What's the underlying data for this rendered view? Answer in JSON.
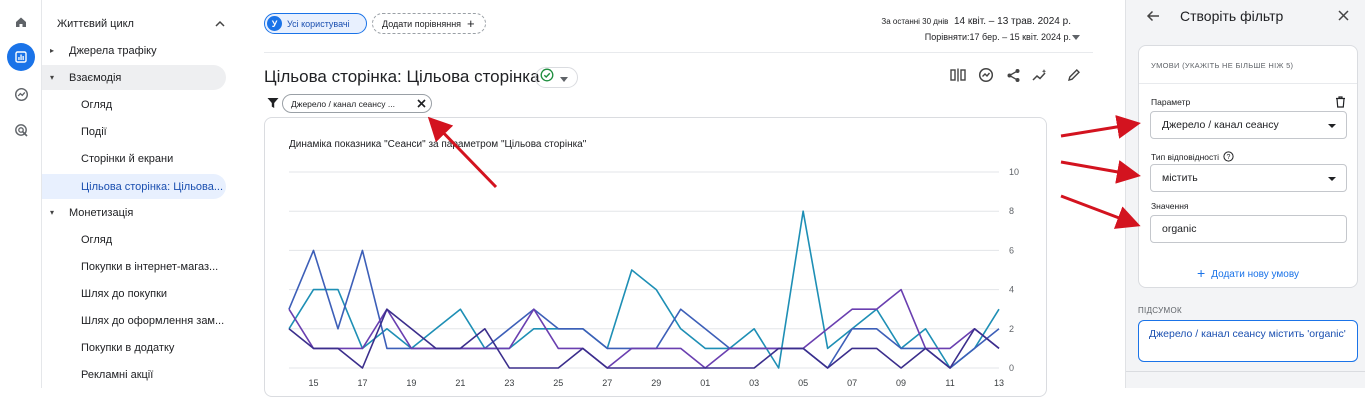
{
  "sidebar": {
    "top_group": "Життєвий цикл",
    "items": [
      {
        "label": "Джерела трафіку",
        "kind": "group",
        "expanded": false
      },
      {
        "label": "Взаємодія",
        "kind": "group",
        "expanded": true
      },
      {
        "label": "Огляд",
        "kind": "child"
      },
      {
        "label": "Події",
        "kind": "child"
      },
      {
        "label": "Сторінки й екрани",
        "kind": "child"
      },
      {
        "label": "Цільова сторінка: Цільова...",
        "kind": "child",
        "selected": true
      },
      {
        "label": "Монетизація",
        "kind": "group",
        "expanded": true
      },
      {
        "label": "Огляд",
        "kind": "child"
      },
      {
        "label": "Покупки в інтернет-магаз...",
        "kind": "child"
      },
      {
        "label": "Шлях до покупки",
        "kind": "child"
      },
      {
        "label": "Шлях до оформлення зам...",
        "kind": "child"
      },
      {
        "label": "Покупки в додатку",
        "kind": "child"
      },
      {
        "label": "Рекламні акції",
        "kind": "child"
      }
    ]
  },
  "header": {
    "avatar_letter": "У",
    "users_chip": "Усі користувачі",
    "compare_chip": "Додати порівняння",
    "date_prefix": "За останні 30 днів",
    "date_range": "14 квіт. – 13 трав. 2024 р.",
    "compare_range": "Порівняти:17 бер. – 15 квіт. 2024 р."
  },
  "page": {
    "title": "Цільова сторінка: Цільова сторінка",
    "filter_chip": "Джерело / канал сеансу ..."
  },
  "chart_data": {
    "type": "line",
    "title": "Динаміка показника \"Сеанси\" за параметром \"Цільова сторінка\"",
    "x": [
      "14",
      "15",
      "16",
      "17",
      "18",
      "19",
      "20",
      "21",
      "22",
      "23",
      "24",
      "25",
      "26",
      "27",
      "28",
      "29",
      "30",
      "01",
      "02",
      "03",
      "04",
      "05",
      "06",
      "07",
      "08",
      "09",
      "10",
      "11",
      "12",
      "13"
    ],
    "x_tick_labels": [
      "15",
      "17",
      "19",
      "21",
      "23",
      "25",
      "27",
      "29",
      "01",
      "03",
      "05",
      "07",
      "09",
      "11",
      "13"
    ],
    "y_ticks": [
      0,
      2,
      4,
      6,
      8,
      10
    ],
    "ylim": [
      0,
      10
    ],
    "grid": true,
    "series": [
      {
        "color": "#1e8fb5",
        "values": [
          2,
          4,
          4,
          1,
          2,
          1,
          2,
          3,
          1,
          1,
          2,
          2,
          2,
          1,
          5,
          4,
          2,
          1,
          1,
          2,
          0,
          8,
          1,
          2,
          3,
          1,
          2,
          0,
          1,
          3
        ]
      },
      {
        "color": "#3d5fb8",
        "values": [
          3,
          6,
          2,
          6,
          1,
          1,
          1,
          1,
          1,
          2,
          3,
          2,
          2,
          1,
          1,
          1,
          3,
          2,
          1,
          1,
          1,
          1,
          0,
          2,
          2,
          1,
          1,
          0,
          1,
          2
        ]
      },
      {
        "color": "#6a3fb0",
        "values": [
          3,
          1,
          1,
          1,
          3,
          1,
          1,
          1,
          1,
          1,
          3,
          1,
          1,
          0,
          1,
          1,
          1,
          0,
          1,
          1,
          1,
          1,
          2,
          3,
          3,
          4,
          1,
          1,
          2,
          1
        ]
      },
      {
        "color": "#3b2e8c",
        "values": [
          2,
          1,
          1,
          0,
          3,
          2,
          1,
          1,
          2,
          0,
          0,
          0,
          1,
          0,
          0,
          0,
          0,
          0,
          0,
          0,
          1,
          1,
          0,
          1,
          1,
          0,
          1,
          0,
          2,
          1
        ]
      }
    ]
  },
  "panel": {
    "title": "Створіть фільтр",
    "conditions_header": "УМОВИ (УКАЖІТЬ НЕ БІЛЬШЕ НІЖ 5)",
    "param_label": "Параметр",
    "param_value": "Джерело / канал сеансу",
    "match_label": "Тип відповідності",
    "match_value": "містить",
    "value_label": "Значення",
    "value_input": "organic",
    "add_condition": "Додати нову умову",
    "summary_label": "ПІДСУМОК",
    "summary_text": "Джерело / канал сеансу містить 'organic'"
  },
  "colors": {
    "accent": "#1a73e8",
    "arrow": "#d3131f"
  }
}
